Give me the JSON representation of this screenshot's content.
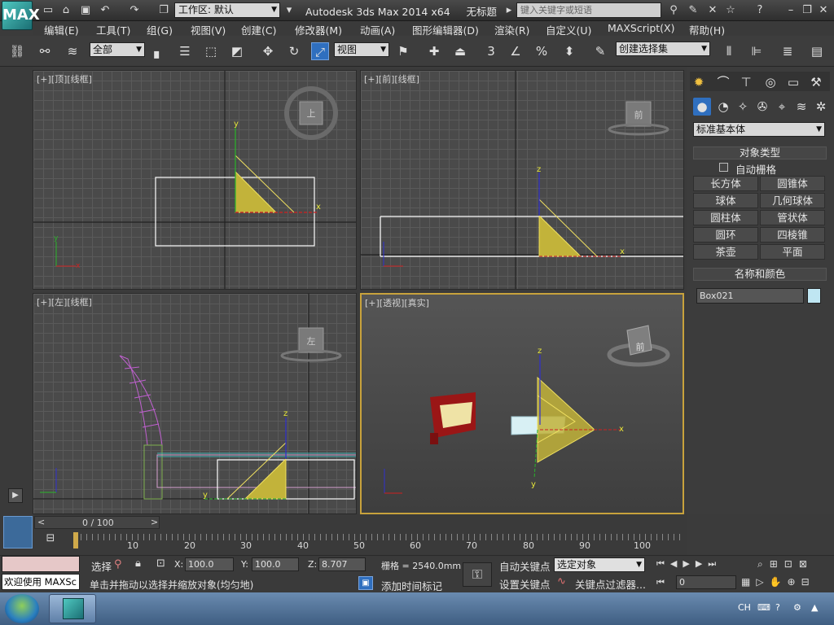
{
  "titlebar": {
    "app_logo": "MAX",
    "workspace_label": "工作区: 默认",
    "app_title": "Autodesk 3ds Max  2014 x64",
    "doc_title": "无标题",
    "search_placeholder": "键入关键字或短语"
  },
  "menubar": {
    "items": [
      "编辑(E)",
      "工具(T)",
      "组(G)",
      "视图(V)",
      "创建(C)",
      "修改器(M)",
      "动画(A)",
      "图形编辑器(D)",
      "渲染(R)",
      "自定义(U)",
      "MAXScript(X)",
      "帮助(H)"
    ]
  },
  "toolbar": {
    "selection_filter": "全部",
    "ref_coord": "视图",
    "snap_label": "3",
    "named_selection": "创建选择集"
  },
  "viewports": {
    "top": {
      "label": "[+][顶][线框]",
      "cube": "上"
    },
    "front": {
      "label": "[+][前][线框]",
      "cube": "前"
    },
    "left": {
      "label": "[+][左][线框]",
      "cube": "左"
    },
    "persp": {
      "label": "[+][透视][真实]",
      "cube": "前"
    }
  },
  "command_panel": {
    "category": "标准基本体",
    "object_type_title": "对象类型",
    "autogrid": "自动栅格",
    "objects": [
      "长方体",
      "圆锥体",
      "球体",
      "几何球体",
      "圆柱体",
      "管状体",
      "圆环",
      "四棱锥",
      "茶壶",
      "平面"
    ],
    "name_color_title": "名称和颜色",
    "object_name": "Box021",
    "object_color": "#bfe6f2"
  },
  "timeline": {
    "frame_display": "0 / 100",
    "ticks": [
      "10",
      "20",
      "30",
      "40",
      "50",
      "60",
      "70",
      "80",
      "90",
      "100"
    ]
  },
  "status": {
    "maxscript_label": "欢迎使用 MAXSc",
    "select_label": "选择",
    "x_label": "X:",
    "x_value": "100.0",
    "y_label": "Y:",
    "y_value": "100.0",
    "z_label": "Z:",
    "z_value": "8.707",
    "grid_label": "栅格 = 2540.0mm",
    "prompt": "单击并拖动以选择并缩放对象(均匀地)",
    "add_time_tag": "添加时间标记",
    "auto_key": "自动关键点",
    "set_key": "设置关键点",
    "key_mode": "选定对象",
    "key_filters": "关键点过滤器...",
    "frame_value": "0"
  },
  "taskbar": {
    "lang": "CH"
  }
}
